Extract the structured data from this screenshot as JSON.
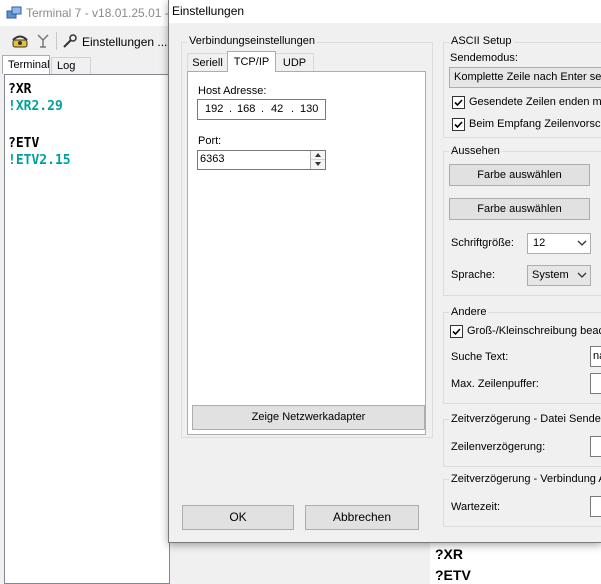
{
  "background_window": {
    "title": "Terminal 7 - v18.01.25.01 -",
    "toolbar": {
      "settings_label": "Einstellungen ..."
    },
    "tabs": [
      "Terminal",
      "Log"
    ],
    "terminal_lines": [
      {
        "text": "?XR",
        "kind": "send"
      },
      {
        "text": "!XR2.29",
        "kind": "recv"
      },
      {
        "text": "",
        "kind": "blank"
      },
      {
        "text": "?ETV",
        "kind": "send"
      },
      {
        "text": "!ETV2.15",
        "kind": "recv"
      }
    ],
    "bottom_lines": [
      "?XR",
      "?ETV"
    ]
  },
  "dialog": {
    "title": "Einstellungen",
    "connection": {
      "group_label": "Verbindungseinstellungen",
      "tabs": [
        "Seriell",
        "TCP/IP",
        "UDP"
      ],
      "active_tab": "TCP/IP",
      "host_label": "Host Adresse:",
      "ip": [
        "192",
        "168",
        "42",
        "130"
      ],
      "port_label": "Port:",
      "port_value": "6363",
      "network_button": "Zeige Netzwerkadapter"
    },
    "ascii": {
      "group_label": "ASCII Setup",
      "send_mode_label": "Sendemodus:",
      "send_mode_value": "Komplette Zeile nach Enter sen",
      "checkbox_lines_end": "Gesendete Zeilen enden mit",
      "checkbox_receive": "Beim Empfang Zeilenvorsch"
    },
    "appearance": {
      "group_label": "Aussehen",
      "color_button_1": "Farbe auswählen",
      "color_button_2": "Farbe auswählen",
      "font_size_label": "Schriftgröße:",
      "font_size_value": "12",
      "language_label": "Sprache:",
      "language_value": "System"
    },
    "other": {
      "group_label": "Andere",
      "case_checkbox": "Groß-/Kleinschreibung beach",
      "search_label": "Suche Text:",
      "search_value": "na",
      "buffer_label": "Max. Zeilenpuffer:"
    },
    "file_delay": {
      "group_label": "Zeitverzögerung - Datei Senden",
      "line_delay_label": "Zeilenverzögerung:"
    },
    "conn_delay": {
      "group_label": "Zeitverzögerung - Verbindung A",
      "wait_label": "Wartezeit:"
    },
    "ok_button": "OK",
    "cancel_button": "Abbrechen"
  }
}
